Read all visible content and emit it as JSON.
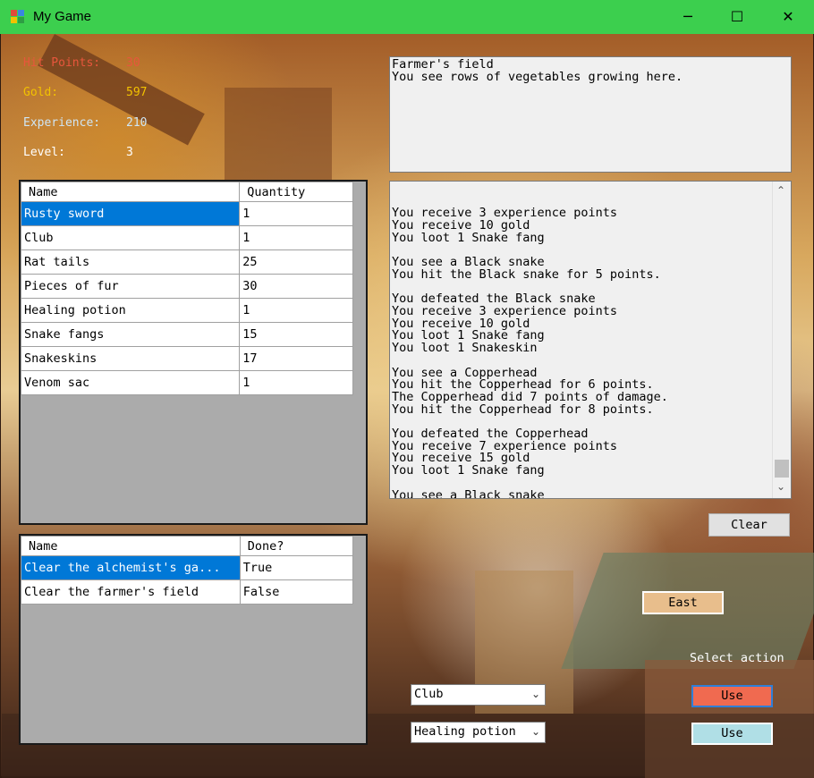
{
  "window": {
    "title": "My Game",
    "minimize": "─",
    "maximize": "☐",
    "close": "✕"
  },
  "stats": {
    "hit_points": {
      "label": "Hit Points:",
      "value": "30",
      "color": "#e8563c"
    },
    "gold": {
      "label": "Gold:",
      "value": "597",
      "color": "#f2c200"
    },
    "experience": {
      "label": "Experience:",
      "value": "210",
      "color": "#cfe6f5"
    },
    "level": {
      "label": "Level:",
      "value": "3",
      "color": "#ffffff"
    }
  },
  "inventory": {
    "headers": [
      "Name",
      "Quantity"
    ],
    "rows": [
      {
        "name": "Rusty sword",
        "qty": "1"
      },
      {
        "name": "Club",
        "qty": "1"
      },
      {
        "name": "Rat tails",
        "qty": "25"
      },
      {
        "name": "Pieces of fur",
        "qty": "30"
      },
      {
        "name": "Healing potion",
        "qty": "1"
      },
      {
        "name": "Snake fangs",
        "qty": "15"
      },
      {
        "name": "Snakeskins",
        "qty": "17"
      },
      {
        "name": "Venom sac",
        "qty": "1"
      }
    ]
  },
  "quests": {
    "headers": [
      "Name",
      "Done?"
    ],
    "rows": [
      {
        "name": "Clear the alchemist's ga...",
        "done": "True"
      },
      {
        "name": "Clear the farmer's field",
        "done": "False"
      }
    ]
  },
  "location": {
    "text": "Farmer's field\nYou see rows of vegetables growing here."
  },
  "messages": {
    "text": "You receive 3 experience points\nYou receive 10 gold\nYou loot 1 Snake fang\n\nYou see a Black snake\nYou hit the Black snake for 5 points.\n\nYou defeated the Black snake\nYou receive 3 experience points\nYou receive 10 gold\nYou loot 1 Snake fang\nYou loot 1 Snakeskin\n\nYou see a Copperhead\nYou hit the Copperhead for 6 points.\nThe Copperhead did 7 points of damage.\nYou hit the Copperhead for 8 points.\n\nYou defeated the Copperhead\nYou receive 7 experience points\nYou receive 15 gold\nYou loot 1 Snake fang\n\nYou see a Black snake"
  },
  "buttons": {
    "clear": "Clear",
    "east": "East",
    "select_action": "Select action",
    "use_weapon": "Use",
    "use_potion": "Use"
  },
  "combos": {
    "weapon": "Club",
    "potion": "Healing potion"
  },
  "colors": {
    "titlebar": "#3ccf4e",
    "selection": "#0078d7",
    "east_button": "#e8be8c",
    "use_weapon_button": "#f06a50",
    "use_potion_button": "#b0dfe6"
  }
}
